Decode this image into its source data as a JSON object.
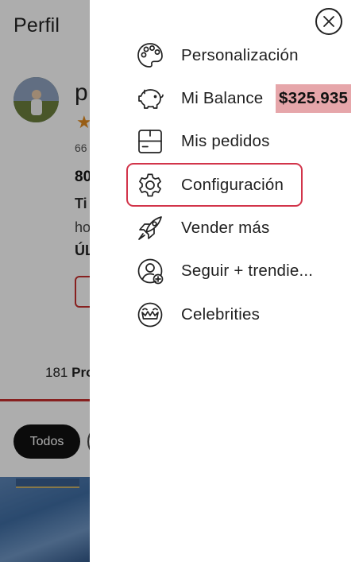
{
  "background": {
    "title": "Perfil",
    "name_partial": "p",
    "star": "★",
    "count_partial": "66",
    "stat_partial": "80",
    "line1_partial": "Ti",
    "line2_partial": "ho",
    "line3_partial": "ÚL",
    "products_count": "181",
    "products_label_partial": "Pro",
    "chip_all": "Todos"
  },
  "drawer": {
    "close_label": "Cerrar",
    "balance_value": "$325.935",
    "highlight_color": "#d2344a",
    "badge_color": "#e6a6aa",
    "items": [
      {
        "label": "Personalización",
        "icon": "palette-icon"
      },
      {
        "label": "Mi Balance",
        "icon": "piggy-bank-icon"
      },
      {
        "label": "Mis pedidos",
        "icon": "box-icon"
      },
      {
        "label": "Configuración",
        "icon": "gear-icon",
        "selected": true
      },
      {
        "label": "Vender más",
        "icon": "rocket-icon"
      },
      {
        "label": "Seguir + trendie...",
        "icon": "user-add-icon"
      },
      {
        "label": "Celebrities",
        "icon": "crown-face-icon"
      }
    ]
  }
}
